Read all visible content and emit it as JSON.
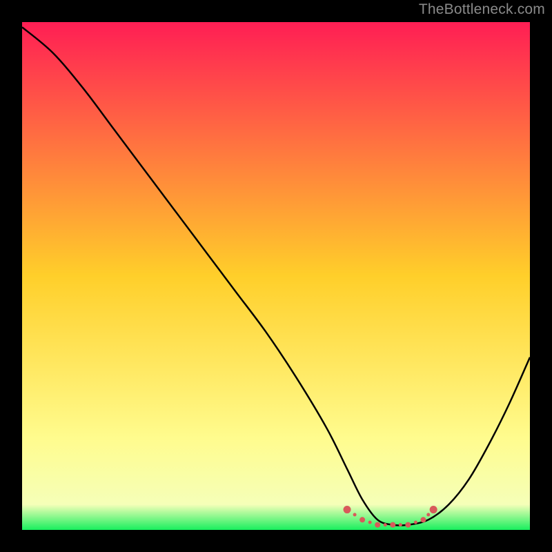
{
  "attribution": "TheBottleneck.com",
  "colors": {
    "bg": "#000000",
    "attribution": "#8a8a8a",
    "curve": "#000000",
    "optimal_dots": "#d85a5a",
    "gradient": [
      {
        "stop": 0.0,
        "color": "#ff1e54"
      },
      {
        "stop": 0.5,
        "color": "#ffcf2a"
      },
      {
        "stop": 0.82,
        "color": "#fffc8e"
      },
      {
        "stop": 0.95,
        "color": "#f5ffb8"
      },
      {
        "stop": 1.0,
        "color": "#18ef5e"
      }
    ]
  },
  "chart_data": {
    "type": "line",
    "title": "",
    "xlabel": "",
    "ylabel": "",
    "xlim": [
      0,
      100
    ],
    "ylim": [
      0,
      100
    ],
    "grid": false,
    "series": [
      {
        "name": "bottleneck-curve",
        "x": [
          0,
          6,
          12,
          18,
          24,
          30,
          36,
          42,
          48,
          54,
          60,
          64,
          67,
          70,
          73,
          76,
          80,
          84,
          88,
          92,
          96,
          100
        ],
        "values": [
          99,
          94,
          87,
          79,
          71,
          63,
          55,
          47,
          39,
          30,
          20,
          12,
          6,
          2,
          1,
          1,
          2,
          5,
          10,
          17,
          25,
          34
        ]
      }
    ],
    "optimal_range": {
      "x": [
        64,
        67,
        70,
        73,
        76,
        79,
        81
      ],
      "y": [
        4,
        2,
        1,
        1,
        1,
        2,
        4
      ]
    },
    "legend": null
  }
}
